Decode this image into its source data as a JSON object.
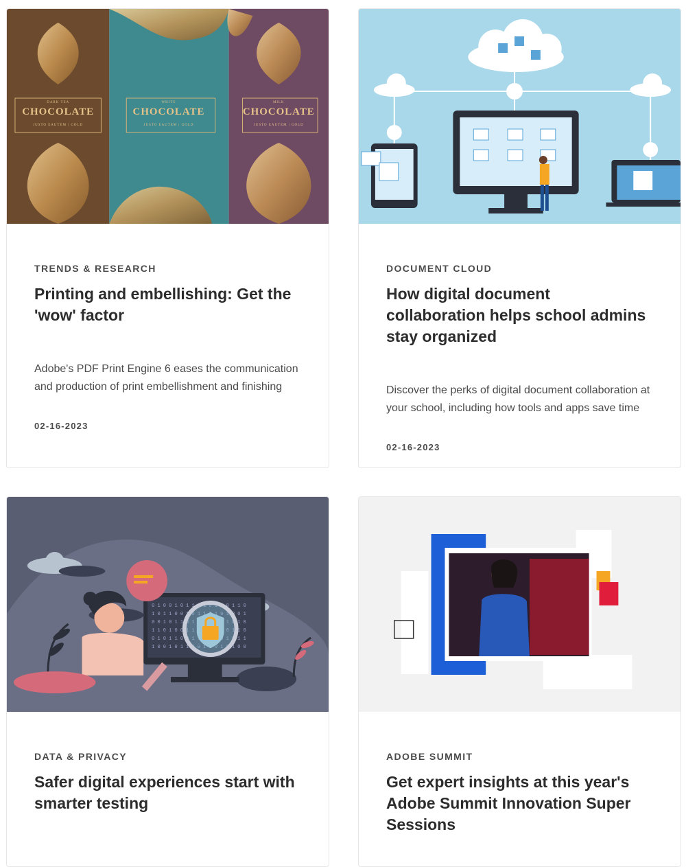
{
  "cards": [
    {
      "category": "TRENDS & RESEARCH",
      "title": "Printing and embellishing: Get the 'wow' factor",
      "description": "Adobe's PDF Print Engine 6 eases the communication and production of print embellishment and finishing to...",
      "date": "02-16-2023",
      "image": {
        "packages": [
          {
            "top_label": "DARK TEA",
            "label": "CHOCOLATE",
            "sub": "JUSTO EAUTEM | GOLD",
            "color": "#6b4a2e"
          },
          {
            "top_label": "WHITE",
            "label": "CHOCOLATE",
            "sub": "JUSTO EAUTEM | GOLD",
            "color": "#3e8a8f"
          },
          {
            "top_label": "MILK",
            "label": "CHOCOLATE",
            "sub": "JUSTO EAUTEM | GOLD",
            "color": "#6f4a63"
          }
        ]
      }
    },
    {
      "category": "DOCUMENT CLOUD",
      "title": "How digital document collaboration helps school admins stay organized",
      "description": "Discover the perks of digital document collaboration at your school, including how tools and apps save time an...",
      "date": "02-16-2023"
    },
    {
      "category": "DATA & PRIVACY",
      "title": "Safer digital experiences start with smarter testing"
    },
    {
      "category": "ADOBE SUMMIT",
      "title": "Get expert insights at this year's Adobe Summit Innovation Super Sessions"
    }
  ],
  "colors": {
    "doc_cloud_bg": "#a8d8ea",
    "privacy_bg": "#5a5e73",
    "summit_bg": "#f2f2f2",
    "summit_blue": "#1d5fd6"
  }
}
